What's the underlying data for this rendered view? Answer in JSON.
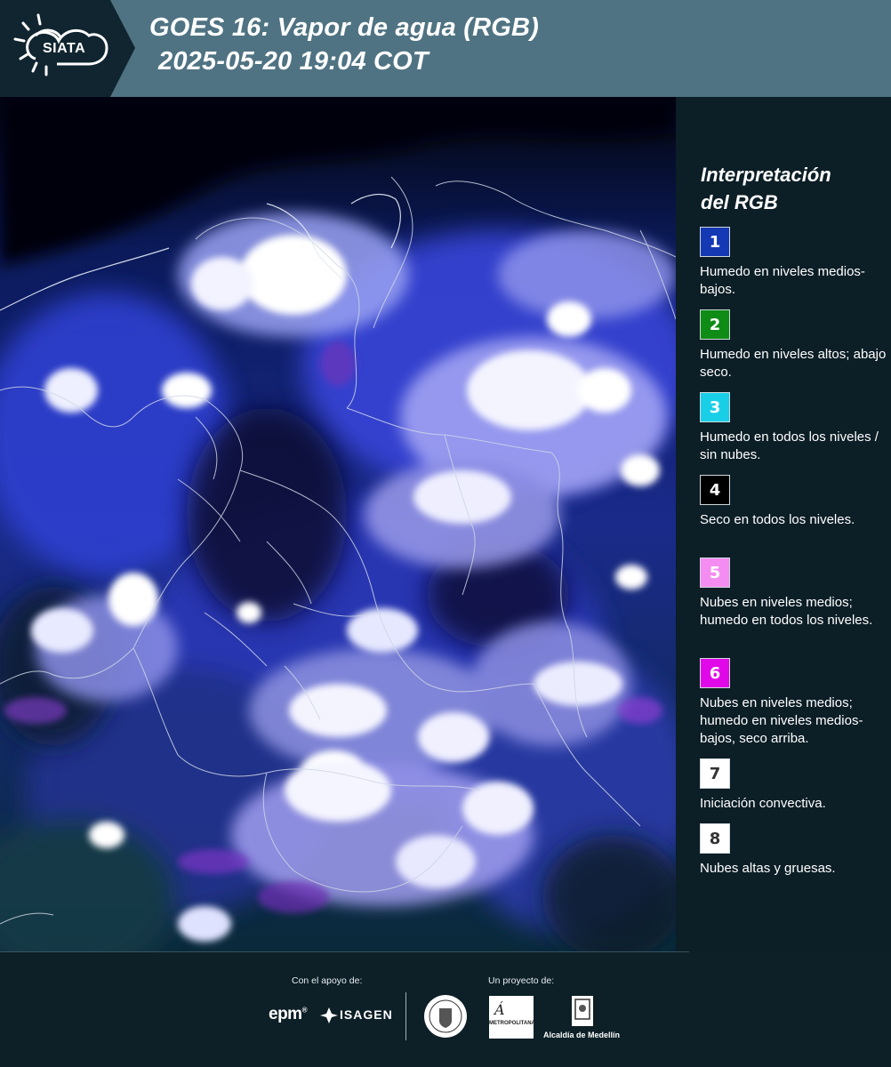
{
  "header": {
    "logo_text": "SIATA",
    "title_line1": "GOES 16: Vapor de agua (RGB)",
    "title_line2": "2025-05-20 19:04 COT"
  },
  "map": {
    "image_description_type": "satellite water vapor RGB composite"
  },
  "legend": {
    "title_line1": "Interpretación",
    "title_line2": "del RGB",
    "items": [
      {
        "num": "1",
        "color": "#1538b4",
        "text": "Humedo en niveles medios-bajos."
      },
      {
        "num": "2",
        "color": "#0e8c16",
        "text": "Humedo en niveles altos; abajo seco."
      },
      {
        "num": "3",
        "color": "#19cfe8",
        "text": "Humedo en todos los niveles / sin nubes."
      },
      {
        "num": "4",
        "color": "#000000",
        "text": "Seco en todos los niveles."
      },
      {
        "num": "5",
        "color": "#f58cf2",
        "text": "Nubes en niveles medios; humedo en todos los niveles."
      },
      {
        "num": "6",
        "color": "#e007e8",
        "text": "Nubes en niveles medios; humedo en niveles medios-bajos, seco arriba."
      },
      {
        "num": "7",
        "color": "#ffffff",
        "text": "Iniciación convectiva."
      },
      {
        "num": "8",
        "color": "#ffffff",
        "text": "Nubes altas y gruesas."
      }
    ]
  },
  "footer": {
    "support_label": "Con el apoyo de:",
    "project_label": "Un proyecto de:",
    "epm_text": "epm",
    "isagen_text": "ISAGEN",
    "amva_text": "METROPOLITANA",
    "alcaldia_text": "Alcaldía de Medellín"
  }
}
